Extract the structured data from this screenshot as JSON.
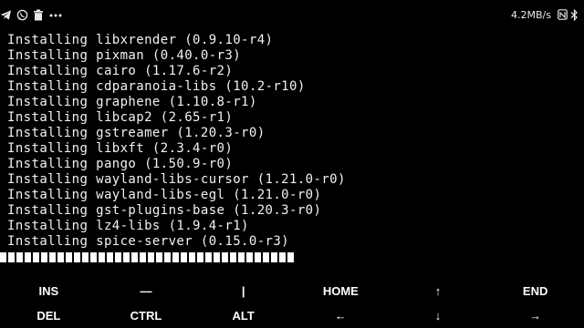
{
  "statusbar": {
    "left_icons": [
      "telegram-icon",
      "whatsapp-icon",
      "trash-icon",
      "more-dots-icon"
    ],
    "network_speed": "4.2MB/s",
    "right_icons": [
      "nfc-icon",
      "bluetooth-icon"
    ]
  },
  "terminal": {
    "lines": [
      "Installing libxrender (0.9.10-r4)",
      "Installing pixman (0.40.0-r3)",
      "Installing cairo (1.17.6-r2)",
      "Installing cdparanoia-libs (10.2-r10)",
      "Installing graphene (1.10.8-r1)",
      "Installing libcap2 (2.65-r1)",
      "Installing gstreamer (1.20.3-r0)",
      "Installing libxft (2.3.4-r0)",
      "Installing pango (1.50.9-r0)",
      "Installing wayland-libs-cursor (1.21.0-r0)",
      "Installing wayland-libs-egl (1.21.0-r0)",
      "Installing gst-plugins-base (1.20.3-r0)",
      "Installing lz4-libs (1.9.4-r1)",
      "Installing spice-server (0.15.0-r3)"
    ],
    "progress_blocks": 36
  },
  "extra_keys": {
    "row1": [
      "INS",
      "—",
      "|",
      "HOME",
      "↑",
      "END"
    ],
    "row2": [
      "DEL",
      "CTRL",
      "ALT",
      "←",
      "↓",
      "→"
    ]
  },
  "colors": {
    "background": "#000000",
    "text": "#ffffff"
  }
}
